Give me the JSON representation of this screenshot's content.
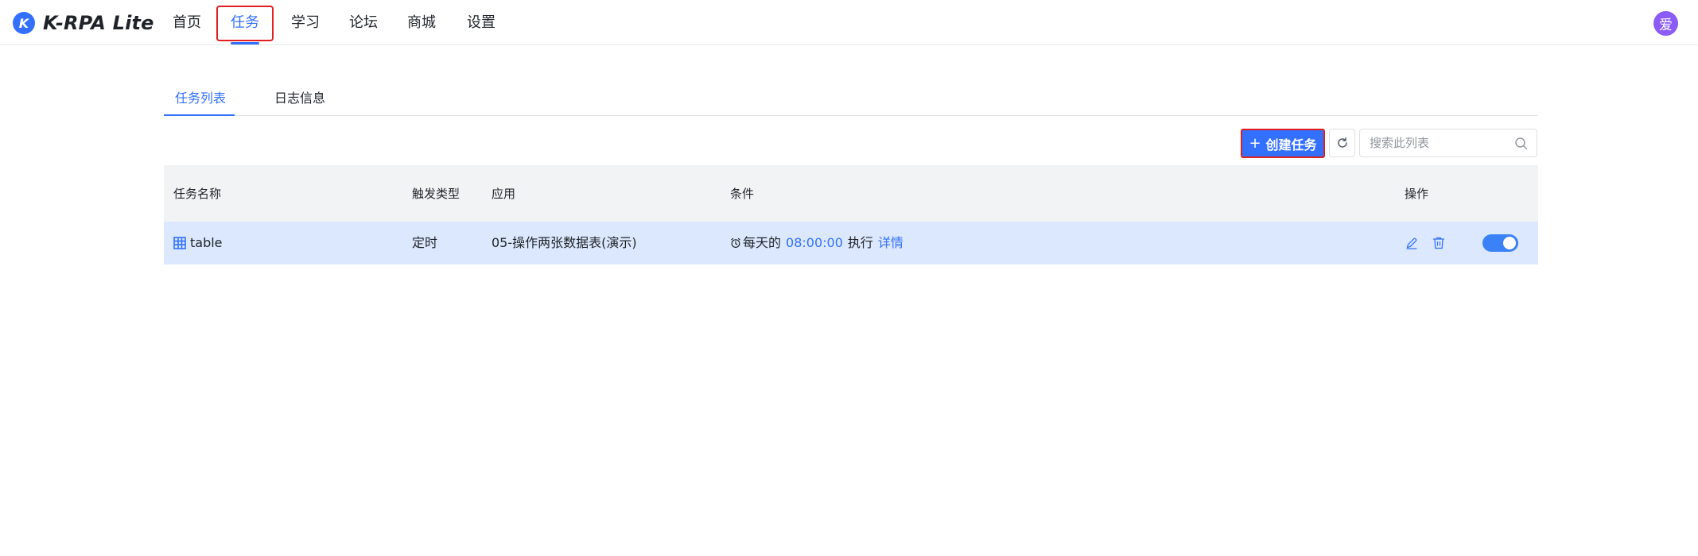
{
  "app": {
    "logo_letter": "K",
    "title": "K-RPA Lite",
    "accent_color": "#3370ff"
  },
  "nav": {
    "items": [
      {
        "label": "首页"
      },
      {
        "label": "任务"
      },
      {
        "label": "学习"
      },
      {
        "label": "论坛"
      },
      {
        "label": "商城"
      },
      {
        "label": "设置"
      }
    ],
    "active": "任务"
  },
  "user": {
    "avatar_text": "爱",
    "avatar_color": "#8b5cf6"
  },
  "tabs": {
    "items": [
      {
        "label": "任务列表"
      },
      {
        "label": "日志信息"
      }
    ],
    "active": "任务列表"
  },
  "toolbar": {
    "create_label": "创建任务",
    "create_icon": "plus-icon",
    "refresh_icon": "refresh-icon",
    "search_placeholder": "搜索此列表",
    "search_icon": "search-icon"
  },
  "table": {
    "columns": [
      "任务名称",
      "触发类型",
      "应用",
      "条件",
      "操作"
    ],
    "rows": [
      {
        "icon": "table-icon",
        "name": "table",
        "trigger": "定时",
        "app": "05-操作两张数据表(演示)",
        "condition": {
          "icon": "alarm-clock-icon",
          "prefix": "每天的",
          "time": "08:00:00",
          "action": "执行",
          "detail_link": "详情"
        },
        "actions": [
          "edit-icon",
          "delete-icon"
        ],
        "enabled": true
      }
    ]
  }
}
